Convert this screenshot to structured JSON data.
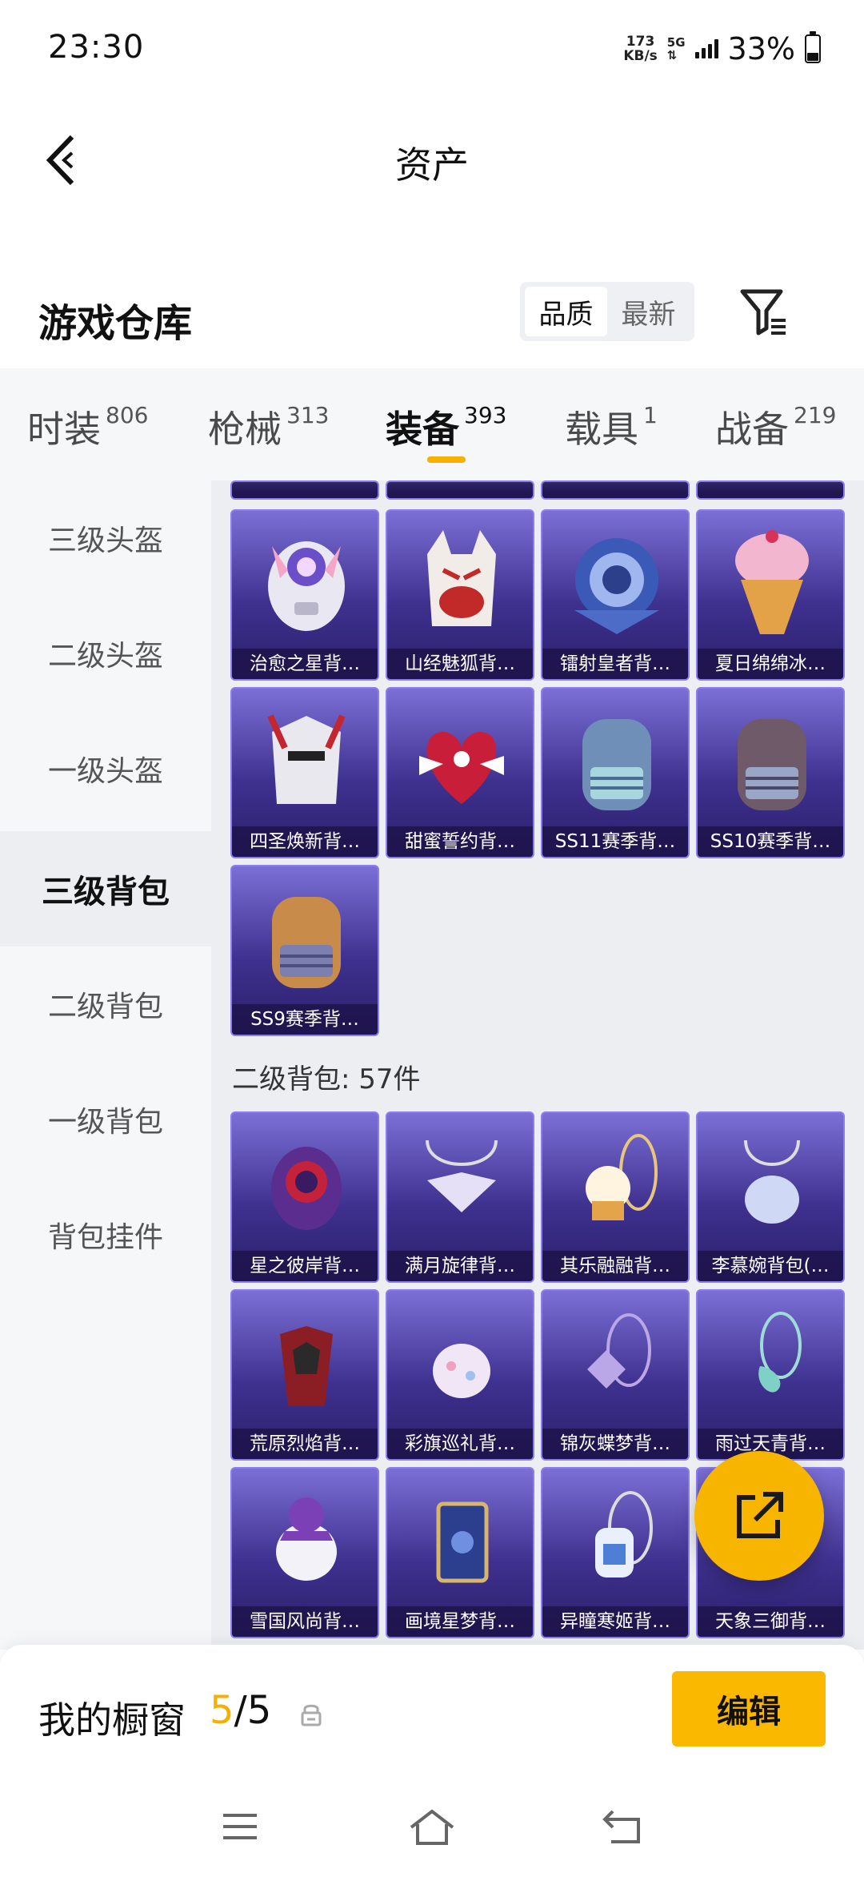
{
  "status": {
    "time": "23:30",
    "net_speed_value": "173",
    "net_speed_unit": "KB/s",
    "network": "5G",
    "battery": "33%",
    "battery_level": 0.33
  },
  "header": {
    "title": "资产"
  },
  "warehouse": {
    "title": "游戏仓库",
    "sort_options": [
      "品质",
      "最新"
    ],
    "active_sort": "品质"
  },
  "tabs": [
    {
      "label": "时装",
      "count": "806"
    },
    {
      "label": "枪械",
      "count": "313"
    },
    {
      "label": "装备",
      "count": "393",
      "active": true
    },
    {
      "label": "载具",
      "count": "1"
    },
    {
      "label": "战备",
      "count": "219"
    }
  ],
  "sidebar": [
    {
      "label": "三级头盔"
    },
    {
      "label": "二级头盔"
    },
    {
      "label": "一级头盔"
    },
    {
      "label": "三级背包",
      "active": true
    },
    {
      "label": "二级背包"
    },
    {
      "label": "一级背包"
    },
    {
      "label": "背包挂件"
    }
  ],
  "level3_backpacks": [
    "治愈之星背…",
    "山经魅狐背…",
    "镭射皇者背…",
    "夏日绵绵冰…",
    "四圣焕新背…",
    "甜蜜誓约背…",
    "SS11赛季背…",
    "SS10赛季背…",
    "SS9赛季背…"
  ],
  "level2_section": {
    "title": "二级背包: 57件",
    "items": [
      "星之彼岸背…",
      "满月旋律背…",
      "其乐融融背…",
      "李慕婉背包(…",
      "荒原烈焰背…",
      "彩旗巡礼背…",
      "锦灰蝶梦背…",
      "雨过天青背…",
      "雪国风尚背…",
      "画境星梦背…",
      "异瞳寒姬背…",
      "天象三御背…"
    ]
  },
  "showcase": {
    "label": "我的橱窗",
    "current": "5",
    "total": "/5",
    "edit_label": "编辑"
  },
  "colors": {
    "accent": "#f5b000",
    "card_top": "#7b6fd6",
    "card_bottom": "#2a1f6b"
  }
}
